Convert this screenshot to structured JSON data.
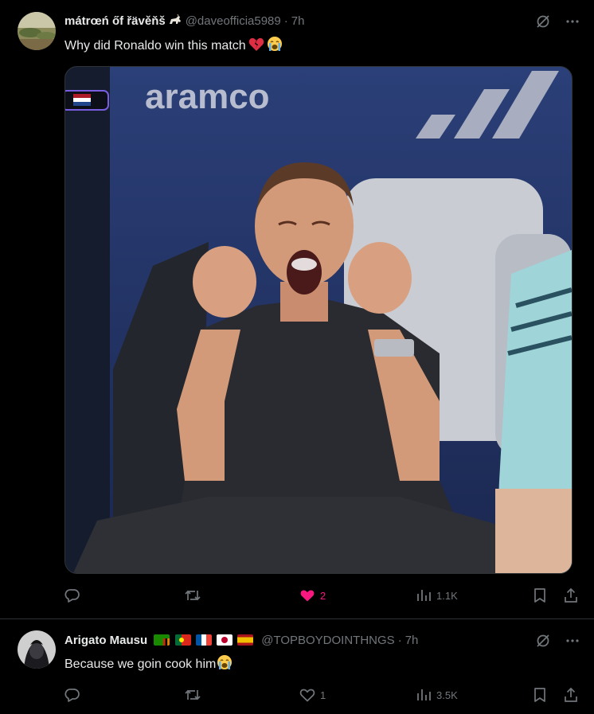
{
  "post": {
    "display_name": "mátrœń őf řävěňš",
    "handle": "@daveofficia5989",
    "separator": "·",
    "time": "7h",
    "text": "Why did Ronaldo win this match",
    "media_text": {
      "sponsor": "aramco"
    },
    "metrics": {
      "replies": "",
      "reposts": "",
      "likes": "2",
      "views": "1.1K"
    },
    "liked": true
  },
  "reply": {
    "display_name": "Arigato Mausu",
    "handle": "@TOPBOYDOINTHNGS",
    "separator": "·",
    "time": "7h",
    "text": "Because we goin cook him",
    "metrics": {
      "replies": "",
      "reposts": "",
      "likes": "1",
      "views": "3.5K"
    }
  },
  "icons": {
    "grok": "grok-icon",
    "more": "more-icon",
    "reply": "reply-icon",
    "repost": "repost-icon",
    "like": "heart-icon",
    "views": "views-icon",
    "bookmark": "bookmark-icon",
    "share": "share-icon"
  },
  "colors": {
    "background": "#000000",
    "text": "#e7e9ea",
    "muted": "#71767b",
    "like_active": "#f91880",
    "divider": "#2f3336"
  }
}
